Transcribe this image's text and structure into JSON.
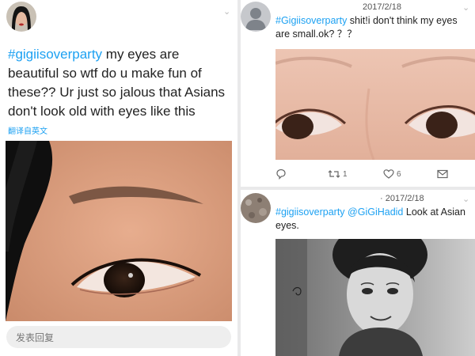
{
  "left_tweet": {
    "handle": "#gigiisoverparty",
    "text": " my eyes are beautiful so wtf do u make fun of these?? Ur just so jalous that Asians don't look old with eyes like this",
    "translate_label": "翻译自英文",
    "reply_placeholder": "发表回复"
  },
  "right_top_tweet": {
    "date": "2017/2/18",
    "handle": "#Gigiisoverparty",
    "text": " shit!i don't think my eyes are small.ok? ？？",
    "actions": {
      "retweets": "1",
      "likes": "6"
    }
  },
  "right_bottom_tweet": {
    "date": "· 2017/2/18",
    "handle": "#gigiisoverparty",
    "mention": "@GiGiHadid",
    "text": "  Look at Asian eyes."
  },
  "icons": [
    "chevron-down-icon",
    "reply-icon",
    "retweet-icon",
    "like-icon",
    "message-icon",
    "default-avatar-icon"
  ],
  "colors": {
    "link": "#1da1f2",
    "text": "#222222",
    "page_bg": "#e9e9ea"
  }
}
